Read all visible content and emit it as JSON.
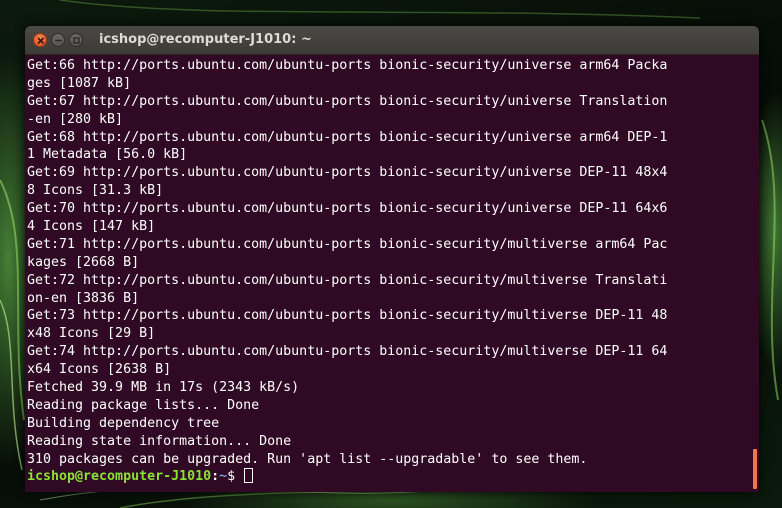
{
  "window": {
    "title": "icshop@recomputer-J1010: ~",
    "buttons": [
      "close-icon",
      "minimize-icon",
      "maximize-icon"
    ]
  },
  "terminal": {
    "lines": [
      "Get:66 http://ports.ubuntu.com/ubuntu-ports bionic-security/universe arm64 Packa",
      "ges [1087 kB]",
      "Get:67 http://ports.ubuntu.com/ubuntu-ports bionic-security/universe Translation",
      "-en [280 kB]",
      "Get:68 http://ports.ubuntu.com/ubuntu-ports bionic-security/universe arm64 DEP-1",
      "1 Metadata [56.0 kB]",
      "Get:69 http://ports.ubuntu.com/ubuntu-ports bionic-security/universe DEP-11 48x4",
      "8 Icons [31.3 kB]",
      "Get:70 http://ports.ubuntu.com/ubuntu-ports bionic-security/universe DEP-11 64x6",
      "4 Icons [147 kB]",
      "Get:71 http://ports.ubuntu.com/ubuntu-ports bionic-security/multiverse arm64 Pac",
      "kages [2668 B]",
      "Get:72 http://ports.ubuntu.com/ubuntu-ports bionic-security/multiverse Translati",
      "on-en [3836 B]",
      "Get:73 http://ports.ubuntu.com/ubuntu-ports bionic-security/multiverse DEP-11 48",
      "x48 Icons [29 B]",
      "Get:74 http://ports.ubuntu.com/ubuntu-ports bionic-security/multiverse DEP-11 64",
      "x64 Icons [2638 B]",
      "Fetched 39.9 MB in 17s (2343 kB/s)",
      "Reading package lists... Done",
      "Building dependency tree",
      "Reading state information... Done",
      "310 packages can be upgraded. Run 'apt list --upgradable' to see them."
    ],
    "prompt": {
      "user_host": "icshop@recomputer-J1010",
      "colon": ":",
      "path": "~",
      "symbol": "$ "
    }
  },
  "colors": {
    "terminal_background": "#300a24",
    "text": "#ffffff",
    "prompt_user": "#8ae234",
    "prompt_path": "#729fcf",
    "close_button": "#e05a2a",
    "scroll_indicator": "#f07746"
  }
}
